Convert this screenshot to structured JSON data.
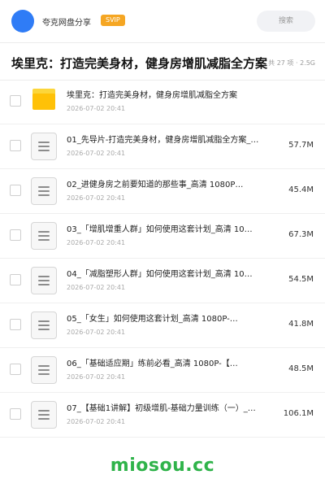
{
  "header": {
    "app_name": "夸克网盘分享",
    "badge": "SVIP",
    "search_label": "搜索",
    "avatar_color": "#2f7cf6"
  },
  "title_row": {
    "title": "埃里克：打造完美身材，健身房增肌减脂全方案",
    "meta": "共 27 项 · 2.5G"
  },
  "files": [
    {
      "type": "folder",
      "name": "埃里克：打造完美身材，健身房增肌减脂全方案",
      "date": "2026-07-02 20:41",
      "size": ""
    },
    {
      "type": "doc",
      "name": "01_先导片-打造完美身材，健身房增肌减脂全方案_…",
      "date": "2026-07-02 20:41",
      "size": "57.7M"
    },
    {
      "type": "doc",
      "name": "02_进健身房之前要知道的那些事_高清 1080P…",
      "date": "2026-07-02 20:41",
      "size": "45.4M"
    },
    {
      "type": "doc",
      "name": "03_「增肌增重人群」如何使用这套计划_高清 10…",
      "date": "2026-07-02 20:41",
      "size": "67.3M"
    },
    {
      "type": "doc",
      "name": "04_「减脂塑形人群」如何使用这套计划_高清 10…",
      "date": "2026-07-02 20:41",
      "size": "54.5M"
    },
    {
      "type": "doc",
      "name": "05_「女生」如何使用这套计划_高清 1080P-…",
      "date": "2026-07-02 20:41",
      "size": "41.8M"
    },
    {
      "type": "doc",
      "name": "06_「基础适应期」练前必看_高清 1080P-【…",
      "date": "2026-07-02 20:41",
      "size": "48.5M"
    },
    {
      "type": "doc",
      "name": "07_【基础1讲解】初级增肌-基础力量训练（一）_…",
      "date": "2026-07-02 20:41",
      "size": "106.1M"
    }
  ],
  "watermark": "miosou.cc",
  "colors": {
    "svip": "#f5a623",
    "folder": "#ffc107",
    "watermark": "#2fb34a"
  }
}
